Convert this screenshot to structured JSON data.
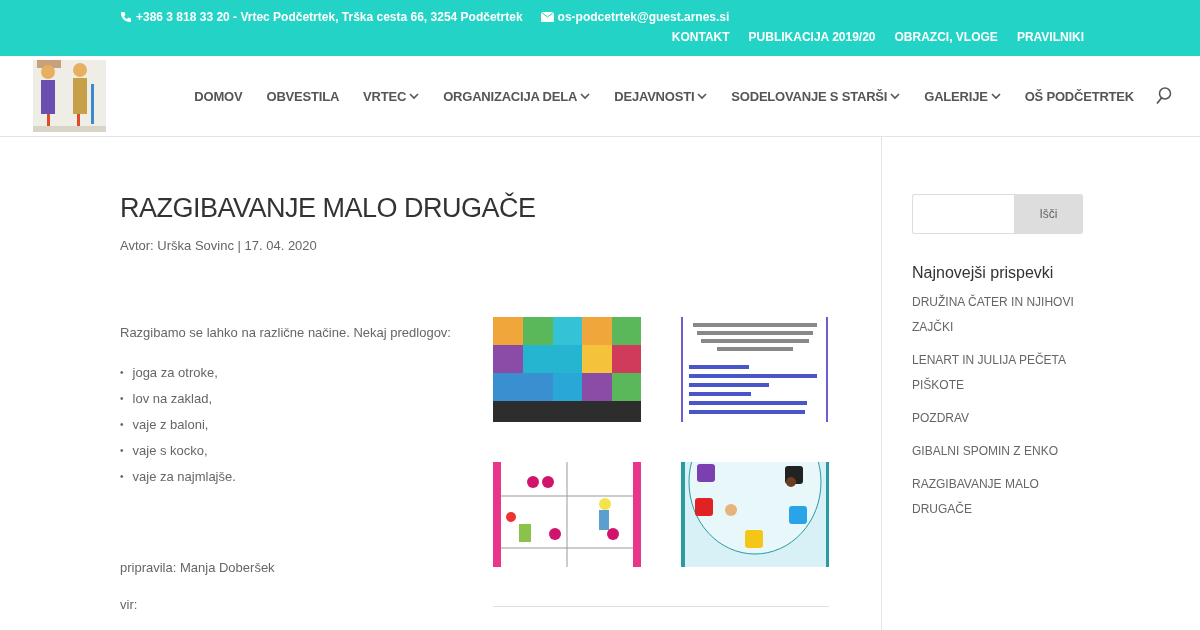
{
  "top_bar": {
    "phone": "+386 3 818 33 20 - Vrtec Podčetrtek, Trška cesta 66, 3254 Podčetrtek",
    "email": "os-podcetrtek@guest.arnes.si",
    "links": [
      "KONTAKT",
      "PUBLIKACIJA 2019/20",
      "OBRAZCI, VLOGE",
      "PRAVILNIKI"
    ]
  },
  "nav": [
    {
      "label": "DOMOV",
      "dropdown": false
    },
    {
      "label": "OBVESTILA",
      "dropdown": false
    },
    {
      "label": "VRTEC",
      "dropdown": true
    },
    {
      "label": "ORGANIZACIJA DELA",
      "dropdown": true
    },
    {
      "label": "DEJAVNOSTI",
      "dropdown": true
    },
    {
      "label": "SODELOVANJE S STARŠI",
      "dropdown": true
    },
    {
      "label": "GALERIJE",
      "dropdown": true
    },
    {
      "label": "OŠ PODČETRTEK",
      "dropdown": false
    }
  ],
  "post": {
    "title": "RAZGIBAVANJE MALO DRUGAČE",
    "meta": "Avtor: Urška Sovinc | 17. 04. 2020",
    "intro": "Razgibamo se lahko na različne načine. Nekaj predlogov:",
    "list": [
      {
        "bullet": "•",
        "text": "joga za otroke,"
      },
      {
        "bullet": "•",
        "text": "lov na zaklad,"
      },
      {
        "bullet": "•",
        "text": "vaje z baloni,"
      },
      {
        "bullet": "•",
        "text": "vaje s kocko,"
      },
      {
        "bullet": "•",
        "text": "vaje za najmlajše."
      }
    ],
    "author": "pripravila: Manja Doberšek",
    "source_label": "vir:"
  },
  "sidebar": {
    "search_button": "Išči",
    "recent_title": "Najnovejši prispevki",
    "recent": [
      "DRUŽINA ČATER IN NJIHOVI ZAJČKI",
      "LENART IN JULIJA PEČETA PIŠKOTE",
      "POZDRAV",
      "GIBALNI SPOMIN Z ENKO",
      "RAZGIBAVANJE MALO DRUGAČE"
    ]
  }
}
